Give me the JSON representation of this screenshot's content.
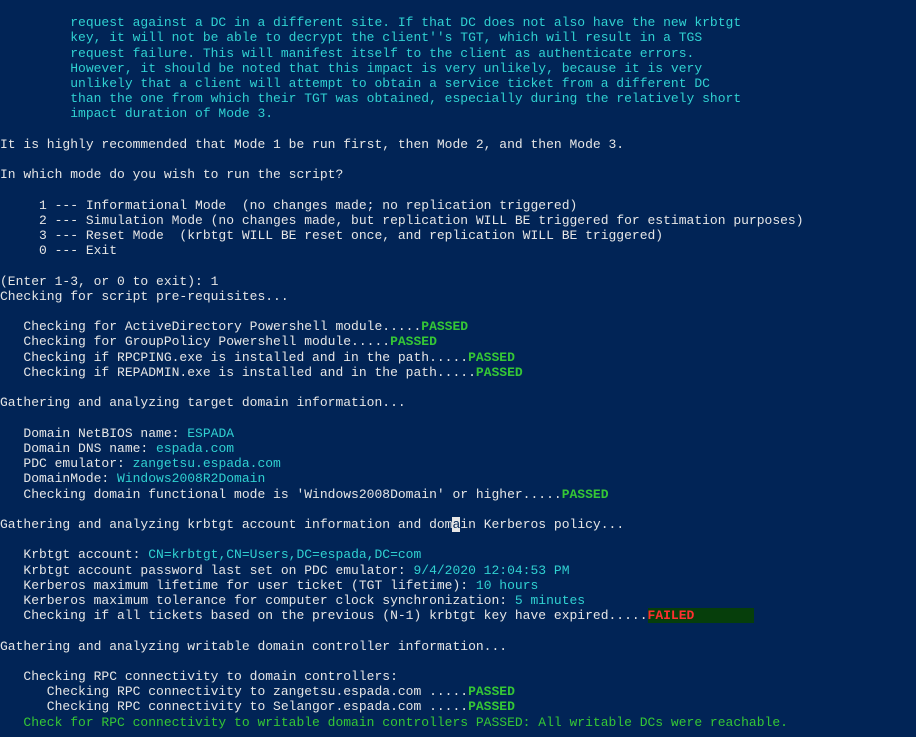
{
  "intro": {
    "l1": "         request against a DC in a different site. If that DC does not also have the new krbtgt",
    "l2": "         key, it will not be able to decrypt the client''s TGT, which will result in a TGS",
    "l3": "         request failure. This will manifest itself to the client as authenticate errors.",
    "l4": "         However, it should be noted that this impact is very unlikely, because it is very",
    "l5": "         unlikely that a client will attempt to obtain a service ticket from a different DC",
    "l6": "         than the one from which their TGT was obtained, especially during the relatively short",
    "l7": "         impact duration of Mode 3."
  },
  "recommend": "It is highly recommended that Mode 1 be run first, then Mode 2, and then Mode 3.",
  "ask": "In which mode do you wish to run the script?",
  "modes": {
    "m1": "     1 --- Informational Mode  (no changes made; no replication triggered)",
    "m2": "     2 --- Simulation Mode (no changes made, but replication WILL BE triggered for estimation purposes)",
    "m3": "     3 --- Reset Mode  (krbtgt WILL BE reset once, and replication WILL BE triggered)",
    "m0": "     0 --- Exit"
  },
  "prompt": "(Enter 1-3, or 0 to exit): 1",
  "preq": {
    "head": "Checking for script pre-requisites...",
    "ad": "   Checking for ActiveDirectory Powershell module.....",
    "gp": "   Checking for GroupPolicy Powershell module.....",
    "rpc": "   Checking if RPCPING.exe is installed and in the path.....",
    "rep": "   Checking if REPADMIN.exe is installed and in the path....."
  },
  "passed": "PASSED",
  "failed": "FAILED",
  "dom": {
    "head": "Gathering and analyzing target domain information...",
    "nb_l": "   Domain NetBIOS name: ",
    "nb_v": "ESPADA",
    "dns_l": "   Domain DNS name: ",
    "dns_v": "espada.com",
    "pdc_l": "   PDC emulator: ",
    "pdc_v": "zangetsu.espada.com",
    "mode_l": "   DomainMode: ",
    "mode_v": "Windows2008R2Domain",
    "func": "   Checking domain functional mode is 'Windows2008Domain' or higher....."
  },
  "krb": {
    "head_a": "Gathering and analyzing krbtgt account information and dom",
    "head_b": "a",
    "head_c": "in Kerberos policy...",
    "acct_l": "   Krbtgt account: ",
    "acct_v": "CN=krbtgt,CN=Users,DC=espada,DC=com",
    "pw_l": "   Krbtgt account password last set on PDC emulator: ",
    "pw_v": "9/4/2020 12:04:53 PM",
    "tgt_l": "   Kerberos maximum lifetime for user ticket (TGT lifetime): ",
    "tgt_v": "10 hours",
    "clock_l": "   Kerberos maximum tolerance for computer clock synchronization: ",
    "clock_v": "5 minutes",
    "exp": "   Checking if all tickets based on the previous (N-1) krbtgt key have expired....."
  },
  "wdc": {
    "head": "Gathering and analyzing writable domain controller information...",
    "rpchead": "   Checking RPC connectivity to domain controllers:",
    "dc1": "      Checking RPC connectivity to zangetsu.espada.com .....",
    "dc2": "      Checking RPC connectivity to Selangor.espada.com .....",
    "ok": "   Check for RPC connectivity to writable domain controllers PASSED: All writable DCs were reachable."
  }
}
